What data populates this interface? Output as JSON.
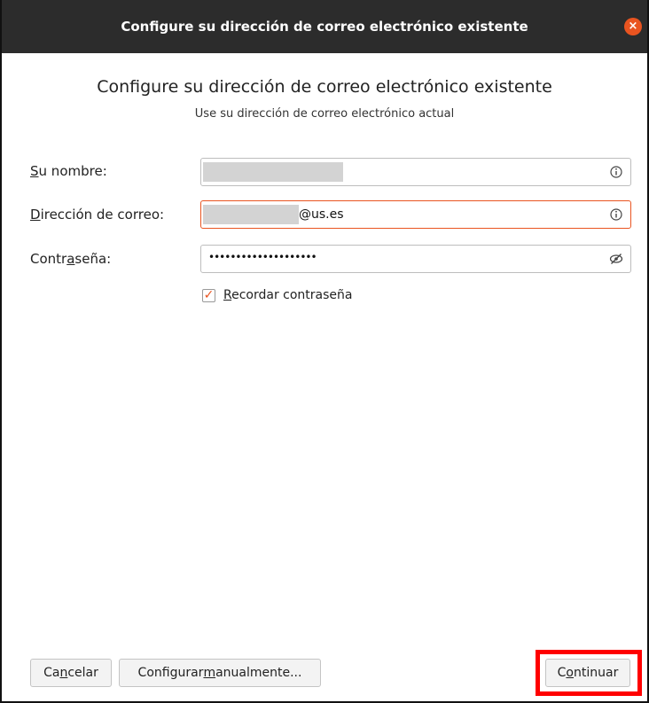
{
  "window": {
    "title": "Configure su dirección de correo electrónico existente",
    "close_glyph": "×"
  },
  "header": {
    "title": "Configure su dirección de correo electrónico existente",
    "subtitle": "Use su dirección de correo electrónico actual"
  },
  "form": {
    "name_label_mnemonic": "S",
    "name_label_rest": "u nombre:",
    "email_label_mnemonic": "D",
    "email_label_rest": "irección de correo:",
    "password_label_pre": "Contr",
    "password_label_mnemonic": "a",
    "password_label_post": "seña:",
    "email_value_visible": "@us.es",
    "password_value": "••••••••••••••••••••",
    "remember_checked": true,
    "remember_label_mnemonic": "R",
    "remember_label_rest": "ecordar contraseña"
  },
  "buttons": {
    "cancel_pre": "Ca",
    "cancel_mnemonic": "n",
    "cancel_post": "celar",
    "manual_pre": "Configurar ",
    "manual_mnemonic": "m",
    "manual_post": "anualmente...",
    "continue_pre": "C",
    "continue_mnemonic": "o",
    "continue_post": "ntinuar"
  },
  "colors": {
    "accent": "#e95420",
    "highlight": "#ff0000",
    "titlebar": "#2c2c2c"
  }
}
